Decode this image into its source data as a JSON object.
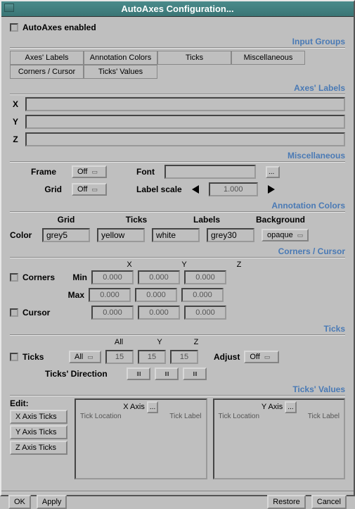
{
  "window": {
    "title": "AutoAxes Configuration..."
  },
  "enabled_label": "AutoAxes enabled",
  "sections": {
    "input_groups": "Input Groups",
    "axes_labels": "Axes' Labels",
    "misc": "Miscellaneous",
    "anno_colors": "Annotation Colors",
    "corners_cursor": "Corners / Cursor",
    "ticks": "Ticks",
    "ticks_values": "Ticks' Values"
  },
  "input_buttons": {
    "r1c1": "Axes' Labels",
    "r1c2": "Annotation Colors",
    "r1c3": "Ticks",
    "r2c1": "Miscellaneous",
    "r2c2": "Corners / Cursor",
    "r2c3": "Ticks' Values"
  },
  "axes": {
    "x": "X",
    "y": "Y",
    "z": "Z",
    "xv": "",
    "yv": "",
    "zv": ""
  },
  "misc": {
    "frame": "Frame",
    "frame_val": "Off",
    "grid": "Grid",
    "grid_val": "Off",
    "font": "Font",
    "font_val": "",
    "label_scale": "Label scale",
    "label_scale_val": "1.000",
    "ellipsis": "..."
  },
  "colors": {
    "label": "Color",
    "grid_h": "Grid",
    "ticks_h": "Ticks",
    "labels_h": "Labels",
    "bg_h": "Background",
    "grid": "grey5",
    "ticks": "yellow",
    "labels": "white",
    "bg": "grey30",
    "opaque": "opaque"
  },
  "corners": {
    "corners": "Corners",
    "cursor": "Cursor",
    "min": "Min",
    "max": "Max",
    "zero": "0.000",
    "X": "X",
    "Y": "Y",
    "Z": "Z"
  },
  "ticks": {
    "label": "Ticks",
    "all": "All",
    "all_val": "All",
    "y": "Y",
    "z": "Z",
    "n": "15",
    "adjust": "Adjust",
    "adjust_val": "Off",
    "dir": "Ticks' Direction"
  },
  "tvalues": {
    "edit": "Edit:",
    "xbtn": "X Axis Ticks",
    "ybtn": "Y Axis Ticks",
    "zbtn": "Z Axis Ticks",
    "xaxis": "X Axis",
    "yaxis": "Y Axis",
    "loc": "Tick Location",
    "lab": "Tick Label",
    "ellipsis": "..."
  },
  "footer": {
    "ok": "OK",
    "apply": "Apply",
    "restore": "Restore",
    "cancel": "Cancel"
  }
}
